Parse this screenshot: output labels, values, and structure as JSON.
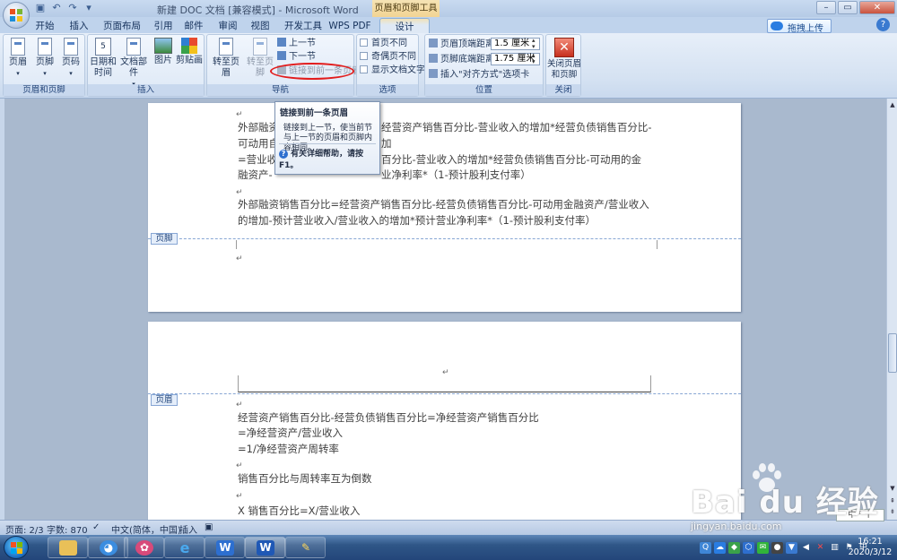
{
  "window": {
    "title": "新建 DOC 文档 [兼容模式] - Microsoft Word",
    "context_title": "页眉和页脚工具"
  },
  "tabs": [
    "开始",
    "插入",
    "页面布局",
    "引用",
    "邮件",
    "审阅",
    "视图",
    "开发工具",
    "WPS PDF",
    "设计"
  ],
  "active_tab": "设计",
  "cloud_upload": "拖拽上传",
  "ribbon": {
    "group_hf": {
      "label": "页眉和页脚",
      "header": "页眉",
      "footer": "页脚",
      "page_number": "页码"
    },
    "group_insert": {
      "label": "插入",
      "datetime": "日期和\n时间",
      "parts": "文档部件",
      "picture": "图片",
      "clipart": "剪贴画"
    },
    "group_nav": {
      "label": "导航",
      "goto_header": "转至页眉",
      "goto_footer": "转至页脚",
      "prev": "上一节",
      "next": "下一节",
      "link_prev": "链接到前一条页眉"
    },
    "group_options": {
      "label": "选项",
      "first_diff": "首页不同",
      "odd_even_diff": "奇偶页不同",
      "show_text": "显示文档文字"
    },
    "group_position": {
      "label": "位置",
      "header_dist_label": "页眉顶端距离:",
      "header_dist_value": "1.5 厘米",
      "footer_dist_label": "页脚底端距离:",
      "footer_dist_value": "1.75 厘米",
      "insert_align_tab": "插入\"对齐方式\"选项卡"
    },
    "group_close": {
      "label": "关闭",
      "close_btn": "关闭页眉\n和页脚"
    }
  },
  "tooltip": {
    "title": "链接到前一条页眉",
    "body": "链接到上一节，使当前节与上一节的页眉和页脚内容相同。",
    "help": "有关详细帮助，请按 F1。"
  },
  "page1": {
    "lines": [
      "外部融资",
      "可动用自",
      "=营业收",
      "融资产-",
      "外部融资销售百分比=经营资产销售百分比-经营负债销售百分比-可动用金融资产/营业收入",
      "的增加-预计营业收入/营业收入的增加*预计营业净利率*（1-预计股利支付率）"
    ],
    "right_fragments": [
      "经营资产销售百分比-营业收入的增加*经营负债销售百分比-",
      "加",
      "百分比-营业收入的增加*经营负债销售百分比-可动用的金",
      "业净利率*（1-预计股利支付率）"
    ],
    "footer_tag": "页脚"
  },
  "page2": {
    "header_tag": "页眉",
    "lines": [
      "经营资产销售百分比-经营负债销售百分比=净经营资产销售百分比",
      "=净经营资产/营业收入",
      "=1/净经营资产周转率",
      "销售百分比与周转率互为倒数",
      "X 销售百分比=X/营业收入"
    ]
  },
  "statusbar": {
    "page": "页面: 2/3",
    "words": "字数: 870",
    "lang": "中文(简体，中国)",
    "mode": "插入"
  },
  "ime": "中 ⁹ 十",
  "watermark": {
    "main": "Bai du 经验",
    "url": "jingyan.baidu.com"
  },
  "clock": {
    "time": "16:21",
    "date": "2020/3/12"
  },
  "colors": {
    "ribbon": "#dfe9f5",
    "accent": "#2e6fcf",
    "highlight_circle": "#e21d1d"
  }
}
